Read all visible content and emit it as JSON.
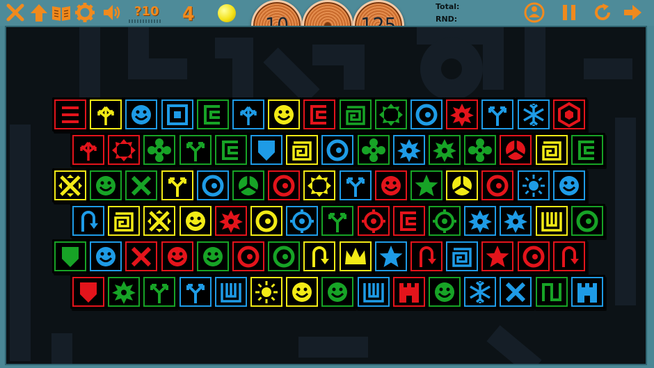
{
  "toolbar": {
    "left_icons": [
      "close-icon",
      "arrow-up-icon",
      "book-icon",
      "gear-icon",
      "speaker-icon"
    ],
    "right_icons": [
      "tutorial-icon",
      "pause-icon",
      "restart-icon",
      "arrow-right-icon"
    ],
    "hint_count": "?10",
    "moves": "4",
    "disc_left": "10",
    "disc_right": "125",
    "total_label": "Total:",
    "rnd_label": "RND:",
    "icon_color": "#f08a1e"
  },
  "colors": {
    "R": "#e3141b",
    "Y": "#f2ea16",
    "B": "#1e9be6",
    "G": "#17a326"
  },
  "rows": [
    {
      "tiles": [
        {
          "c": "R",
          "s": "lines"
        },
        {
          "c": "Y",
          "s": "trident"
        },
        {
          "c": "B",
          "s": "smiley"
        },
        {
          "c": "B",
          "s": "square"
        },
        {
          "c": "G",
          "s": "cshape"
        },
        {
          "c": "B",
          "s": "trident"
        },
        {
          "c": "Y",
          "s": "smiley"
        },
        {
          "c": "R",
          "s": "cshape"
        },
        {
          "c": "G",
          "s": "spiral"
        },
        {
          "c": "G",
          "s": "arrows"
        },
        {
          "c": "B",
          "s": "ring"
        },
        {
          "c": "R",
          "s": "gear"
        },
        {
          "c": "B",
          "s": "fork"
        },
        {
          "c": "B",
          "s": "snow"
        },
        {
          "c": "R",
          "s": "hexagon"
        }
      ]
    },
    {
      "tiles": [
        {
          "c": "R",
          "s": "trident"
        },
        {
          "c": "R",
          "s": "arrows"
        },
        {
          "c": "G",
          "s": "flower"
        },
        {
          "c": "G",
          "s": "fork"
        },
        {
          "c": "G",
          "s": "cshape"
        },
        {
          "c": "B",
          "s": "shield"
        },
        {
          "c": "Y",
          "s": "spiral"
        },
        {
          "c": "B",
          "s": "ring"
        },
        {
          "c": "G",
          "s": "flower"
        },
        {
          "c": "B",
          "s": "gear"
        },
        {
          "c": "G",
          "s": "gear"
        },
        {
          "c": "G",
          "s": "flower"
        },
        {
          "c": "R",
          "s": "tri"
        },
        {
          "c": "Y",
          "s": "spiral"
        },
        {
          "c": "G",
          "s": "cshape"
        }
      ]
    },
    {
      "tiles": [
        {
          "c": "Y",
          "s": "cross"
        },
        {
          "c": "G",
          "s": "smiley"
        },
        {
          "c": "G",
          "s": "x"
        },
        {
          "c": "Y",
          "s": "fork"
        },
        {
          "c": "B",
          "s": "ring"
        },
        {
          "c": "G",
          "s": "tri"
        },
        {
          "c": "R",
          "s": "ring"
        },
        {
          "c": "Y",
          "s": "arrows"
        },
        {
          "c": "B",
          "s": "fork"
        },
        {
          "c": "R",
          "s": "smiley"
        },
        {
          "c": "G",
          "s": "star"
        },
        {
          "c": "Y",
          "s": "tri"
        },
        {
          "c": "R",
          "s": "ring"
        },
        {
          "c": "B",
          "s": "sun"
        },
        {
          "c": "B",
          "s": "smiley"
        }
      ]
    },
    {
      "tiles": [
        {
          "c": "B",
          "s": "hook"
        },
        {
          "c": "Y",
          "s": "spiral"
        },
        {
          "c": "Y",
          "s": "cross"
        },
        {
          "c": "Y",
          "s": "smiley"
        },
        {
          "c": "R",
          "s": "gear"
        },
        {
          "c": "Y",
          "s": "ring"
        },
        {
          "c": "B",
          "s": "ringdots"
        },
        {
          "c": "G",
          "s": "fork"
        },
        {
          "c": "R",
          "s": "ringdots"
        },
        {
          "c": "R",
          "s": "cshape"
        },
        {
          "c": "G",
          "s": "ringdots"
        },
        {
          "c": "B",
          "s": "gear"
        },
        {
          "c": "B",
          "s": "gear"
        },
        {
          "c": "Y",
          "s": "mtooth"
        },
        {
          "c": "G",
          "s": "ring"
        }
      ]
    },
    {
      "tiles": [
        {
          "c": "G",
          "s": "shield"
        },
        {
          "c": "B",
          "s": "smiley"
        },
        {
          "c": "R",
          "s": "x"
        },
        {
          "c": "R",
          "s": "smiley"
        },
        {
          "c": "G",
          "s": "smiley"
        },
        {
          "c": "R",
          "s": "ring"
        },
        {
          "c": "G",
          "s": "ring"
        },
        {
          "c": "Y",
          "s": "hook"
        },
        {
          "c": "Y",
          "s": "crown"
        },
        {
          "c": "B",
          "s": "star"
        },
        {
          "c": "R",
          "s": "hook"
        },
        {
          "c": "B",
          "s": "spiral"
        },
        {
          "c": "R",
          "s": "star"
        },
        {
          "c": "R",
          "s": "ring"
        },
        {
          "c": "R",
          "s": "hook"
        }
      ]
    },
    {
      "tiles": [
        {
          "c": "R",
          "s": "shield"
        },
        {
          "c": "G",
          "s": "gear"
        },
        {
          "c": "G",
          "s": "fork"
        },
        {
          "c": "B",
          "s": "fork"
        },
        {
          "c": "B",
          "s": "mtooth"
        },
        {
          "c": "Y",
          "s": "sun"
        },
        {
          "c": "Y",
          "s": "smiley"
        },
        {
          "c": "G",
          "s": "smiley"
        },
        {
          "c": "B",
          "s": "mtooth"
        },
        {
          "c": "R",
          "s": "castle"
        },
        {
          "c": "G",
          "s": "smiley"
        },
        {
          "c": "B",
          "s": "snow"
        },
        {
          "c": "B",
          "s": "x"
        },
        {
          "c": "G",
          "s": "ntooth"
        },
        {
          "c": "B",
          "s": "castle"
        }
      ]
    }
  ]
}
